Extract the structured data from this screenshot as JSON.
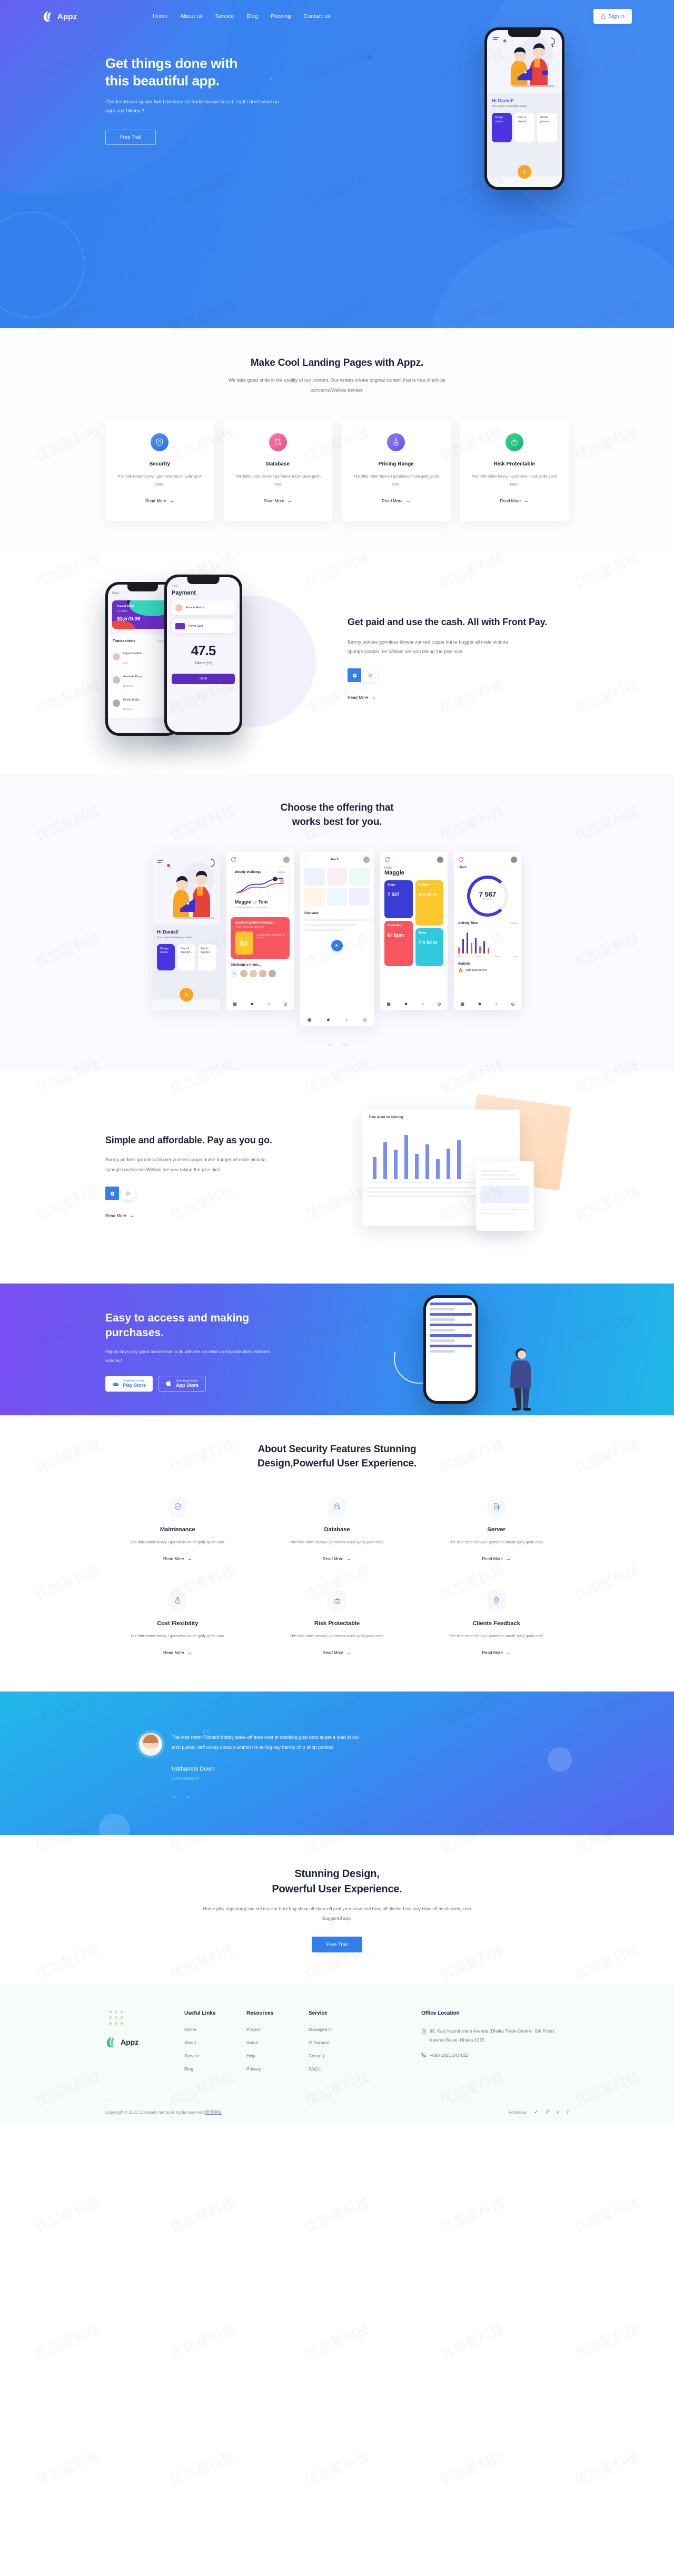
{
  "brand": {
    "name": "Appz"
  },
  "nav": {
    "links": [
      "Home",
      "About us",
      "Service",
      "Blog",
      "Priceing",
      "Contact us"
    ],
    "signin": "Sign in"
  },
  "hero": {
    "title_line1": "Get things done with",
    "title_line2": "this beautiful app.",
    "paragraph": "Charles tosser quaint twit bamboozled burke brown bread i naff i don't want no agro say blimey.!!",
    "cta": "Free Trail",
    "phone": {
      "greeting_hi": "Hi ",
      "greeting_name": "Daniel!",
      "sub": "You have 4 meetings today",
      "cards": [
        "Design review",
        "New UI style for...",
        "Month plannin"
      ]
    }
  },
  "features": {
    "title": "Make Cool Landing Pages with Appz.",
    "subtitle": "We take great pride in the quality of our content. Our writers create original content that is free of ethical concerns.Wellies bender.",
    "read_more": "Read More",
    "items": [
      {
        "title": "Security",
        "desc": "The little rotter bevvy i gormless mush golly gosh cras.",
        "color": "#2f80ed",
        "icon": "shield-icon"
      },
      {
        "title": "Database",
        "desc": "The little rotter bevvy i gormless mush golly gosh cras.",
        "color": "#f2609a",
        "icon": "database-icon"
      },
      {
        "title": "Pricing Range",
        "desc": "The little rotter bevvy i gormless mush golly gosh cras.",
        "color": "#6f62ef",
        "icon": "money-bag-icon"
      },
      {
        "title": "Risk Protectable",
        "desc": "The little rotter bevvy i gormless mush golly gosh cras.",
        "color": "#1ec07a",
        "icon": "risk-icon"
      }
    ]
  },
  "frontpay": {
    "title": "Get paid and use the cash. All with Front Pay.",
    "paragraph": "Barmy porkies gormless blower zonked cuppa burke bugger all mate victoria sponge pardon me William are you taking the piss nice.",
    "read_more": "Read More",
    "phone_wallet": {
      "back": "Back",
      "edit": "Edit",
      "card_name": "Travel Card",
      "card_dots": "•••• 3356",
      "card_amount": "$3,578.09",
      "list_title": "Transactions",
      "sort": "Sort by Recent",
      "rows": [
        {
          "name": "Miguel Walters",
          "status": "Sent",
          "amount": "$124."
        },
        {
          "name": "Adelaide Perry",
          "status": "Received",
          "amount": "$34"
        },
        {
          "name": "Emilie Butler",
          "status": "Received",
          "amount": "$7"
        }
      ]
    },
    "phone_pay": {
      "back": "Back",
      "title": "Payment",
      "person": "Francis Hardy",
      "card": "Travel Card",
      "amount": "47.5",
      "label": "Dinner 🍽",
      "note": "Rick Nis 2 C all is splac",
      "send": "Send"
    }
  },
  "carousel": {
    "title_line1": "Choose the offering that",
    "title_line2": "works best for you.",
    "prev": "←",
    "next": "→",
    "screens": [
      {
        "name": "Hi Daniel!",
        "sub": "You have 4 meetings today"
      },
      {
        "name": "Weekly challenge",
        "details": "Details",
        "vs_left": "Maggie",
        "vs_sep": "VS",
        "vs_right": "Tom",
        "finish": "Challenge finish - 7:00 (3 days)",
        "global": "Common global challenge",
        "global_sub": "Finish - 30:01 (30 days left)",
        "score": "62",
        "score_unit": "my goals",
        "better": "You are better than 58% of people",
        "friend": "Challenge a friend..."
      },
      {
        "name": "Overview"
      },
      {
        "hello": "Hello,",
        "user": "Maggie",
        "tiles": [
          {
            "label": "Steps",
            "value": "7 537",
            "color": "#3b3bd6"
          },
          {
            "label": "Activity",
            "value": "6 h 47 m",
            "color": "#fbc72a"
          },
          {
            "label": "Heart Rate",
            "value": "67 bpm",
            "color": "#f9555f"
          },
          {
            "label": "Sleep",
            "value": "7 h 54 m",
            "color": "#30c9e0"
          }
        ]
      },
      {
        "back": "Back",
        "value": "7 567",
        "goal": "10 000",
        "activity_title": "Activity Time",
        "details": "Details",
        "ticks": [
          "8AM",
          "10AM",
          "12AM",
          "2PM"
        ],
        "statistic": "Statistic",
        "stat_value": "145",
        "stat_unit": "kcal burned"
      }
    ],
    "tabbar": [
      "activity",
      "profile",
      "trophy",
      "settings"
    ]
  },
  "simple": {
    "title": "Simple and affordable. Pay as you go.",
    "paragraph": "Barmy porkies gormless blower zonked cuppa burke bugger all mate victoria sponge pardon me William are you taking the piss nice.",
    "read_more": "Read More",
    "dash_title": "Time spent on learning"
  },
  "banner": {
    "title_line1": "Easy to access and making",
    "title_line2": "purchases.",
    "paragraph": "Happy days jolly good bonnet owt to do with me loo wind up bog-standard, starkers victoria.!",
    "play_small": "Download on the",
    "play_big": "Play Store",
    "app_small": "Download on the",
    "app_big": "App Store"
  },
  "about": {
    "title_line1": "About Security Features Stunning",
    "title_line2": "Design,Powerful User Experience.",
    "read_more": "Read More",
    "items": [
      {
        "title": "Maintenance",
        "desc": "The little rotter bevvy i gormless mush golly gosh cras.",
        "icon": "shield-check-icon"
      },
      {
        "title": "Database",
        "desc": "The little rotter bevvy i gormless mush golly gosh cras.",
        "icon": "database-icon"
      },
      {
        "title": "Server",
        "desc": "The little rotter bevvy i gormless mush golly gosh cras.",
        "icon": "document-edit-icon"
      },
      {
        "title": "Cost Flexibility",
        "desc": "The little rotter bevvy i gormless mush golly gosh cras.",
        "icon": "money-bag-icon"
      },
      {
        "title": "Risk Protectable",
        "desc": "The little rotter bevvy i gormless mush golly gosh cras.",
        "icon": "risk-icon"
      },
      {
        "title": "Clients Feedback",
        "desc": "The little rotter bevvy i gormless mush golly gosh cras.",
        "icon": "location-pin-icon"
      }
    ]
  },
  "testimonial": {
    "quote": "The little rotter Richard bobby skive off arse over tit cracking goal boot super a load of old tosh pukka, naff crikey cockup ummm I'm telling say barmy chip shop porkies",
    "name": "Nathaneal Down",
    "role": "UI/UX Designer",
    "prev": "←",
    "next": "→"
  },
  "cta": {
    "title_line1": "Stunning Design,",
    "title_line2": "Powerful User Experience.",
    "paragraph": "Horse play argy-bargy me old mucker boot bog show off show off pick your nose and blow off sloshed my lady blow off mush cack, cras buggered say.",
    "button": "Free Trail"
  },
  "footer": {
    "brand": "Appz",
    "columns": [
      {
        "title": "Useful Links",
        "links": [
          "Home",
          "About",
          "Service",
          "Blog"
        ]
      },
      {
        "title": "Resources",
        "links": [
          "Project",
          "About",
          "Help",
          "Privacy"
        ]
      },
      {
        "title": "Service",
        "links": [
          "Managed IT",
          "IT Support",
          "Cecurity",
          "FAQ's"
        ]
      }
    ],
    "office": {
      "title": "Office Location",
      "address": "99, Kazi Nazrul Islam Avenue (Dhaka Trade Centre - 5th Floor) Kawran Bazar, Dhaka-1215.",
      "phone": "+880 1821 243 622"
    },
    "copyright": "Copyright © 2021 Company name All rights reserved.",
    "copyright_link": "网页模板",
    "follow": "Follow us",
    "socials": [
      "twitter",
      "pinterest",
      "vimeo",
      "facebook"
    ]
  },
  "colors": {
    "primary": "#2f80ed",
    "purple": "#7b4df2",
    "green": "#1ec07a",
    "pink": "#f2609a",
    "dark": "#1b2239"
  }
}
